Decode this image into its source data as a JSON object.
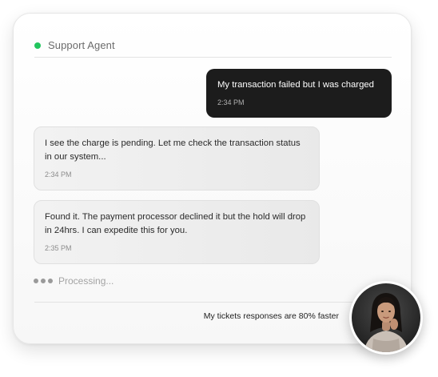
{
  "header": {
    "agent_name": "Support Agent",
    "status_color": "#22c55e"
  },
  "messages": [
    {
      "sender": "user",
      "text": "My transaction failed but I was charged",
      "time": "2:34 PM"
    },
    {
      "sender": "agent",
      "text": "I see the charge is pending. Let me check the transaction status in our system...",
      "time": "2:34 PM"
    },
    {
      "sender": "agent",
      "text": "Found it. The payment processor declined it but the hold will drop in 24hrs. I can expedite this for you.",
      "time": "2:35 PM"
    }
  ],
  "typing_indicator": {
    "label": "Processing..."
  },
  "footer": {
    "stat_text": "My tickets responses are 80% faster"
  },
  "avatar": {
    "icon": "agent-photo"
  }
}
